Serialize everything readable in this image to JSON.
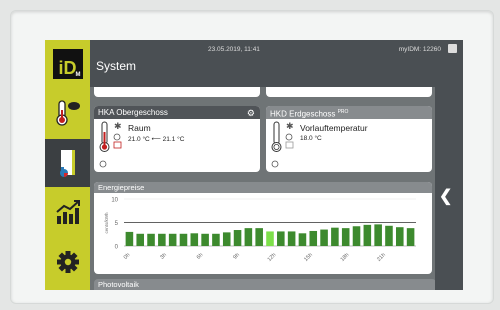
{
  "header": {
    "title": "System",
    "datetime": "23.05.2019, 11:41",
    "user": "myIDM: 12260"
  },
  "sidebar": {
    "logo_text": "iD",
    "logo_sub": "M",
    "items": [
      {
        "name": "thermometer-pro",
        "active": false
      },
      {
        "name": "building",
        "active": true
      },
      {
        "name": "statistics",
        "active": false
      },
      {
        "name": "settings",
        "active": false
      }
    ]
  },
  "cards": [
    {
      "title": "HKA Obergeschoss",
      "pro": "",
      "label": "Raum",
      "value": "21.0 °C ⟵ 21.1 °C",
      "style": "dark"
    },
    {
      "title": "HKD Erdgeschoss",
      "pro": "PRO",
      "label": "Vorlauftemperatur",
      "value": "18.0 °C",
      "style": "light"
    }
  ],
  "energy": {
    "title": "Energiepreise",
    "ylabel": "cents/kWh",
    "xticks": [
      "0h",
      "3h",
      "6h",
      "9h",
      "12h",
      "15h",
      "18h",
      "21h"
    ]
  },
  "chart_data": {
    "type": "bar",
    "ylabel": "cents/kWh",
    "ylim": [
      0,
      10
    ],
    "yticks": [
      0,
      5,
      10
    ],
    "xticks": [
      "0h",
      "3h",
      "6h",
      "9h",
      "12h",
      "15h",
      "18h",
      "21h"
    ],
    "values": [
      3.0,
      2.6,
      2.6,
      2.6,
      2.6,
      2.6,
      2.7,
      2.6,
      2.6,
      2.9,
      3.4,
      3.8,
      3.8,
      3.1,
      3.1,
      3.1,
      2.7,
      3.2,
      3.5,
      3.9,
      3.8,
      4.2,
      4.5,
      4.6,
      4.3,
      4.0,
      3.8
    ],
    "current_index": 13,
    "bar_color": "#3d8a2e",
    "current_color": "#7de04a",
    "threshold": 5
  },
  "photovoltaik": {
    "title": "Photovoltaik"
  },
  "colors": {
    "accent": "#c7cc2b",
    "dark": "#4a4f53"
  }
}
